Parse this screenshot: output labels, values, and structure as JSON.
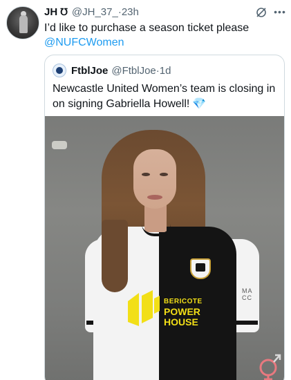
{
  "tweet": {
    "author_name": "JH",
    "author_icon": "headphones-icon",
    "handle": "@JH_37_",
    "separator": "·",
    "time": "23h",
    "text": "I’d like to purchase a season ticket please",
    "mention": "@NUFCWomen"
  },
  "quote": {
    "author_name": "FtblJoe",
    "handle": "@FtblJoe",
    "separator": "·",
    "time": "1d",
    "text": "Newcastle United Women’s team is closing in on signing Gabriella Howell!",
    "emoji": "💎"
  },
  "media": {
    "sponsor_line1": "BERICOTE",
    "sponsor_line2": "POWER",
    "sponsor_line3": "HOUSE",
    "side_text_1": "MA",
    "side_text_2": "CC"
  },
  "colors": {
    "link": "#1d9bf0",
    "secondary_text": "#536471",
    "border": "#cfd9de",
    "sponsor_yellow": "#f2df17"
  }
}
